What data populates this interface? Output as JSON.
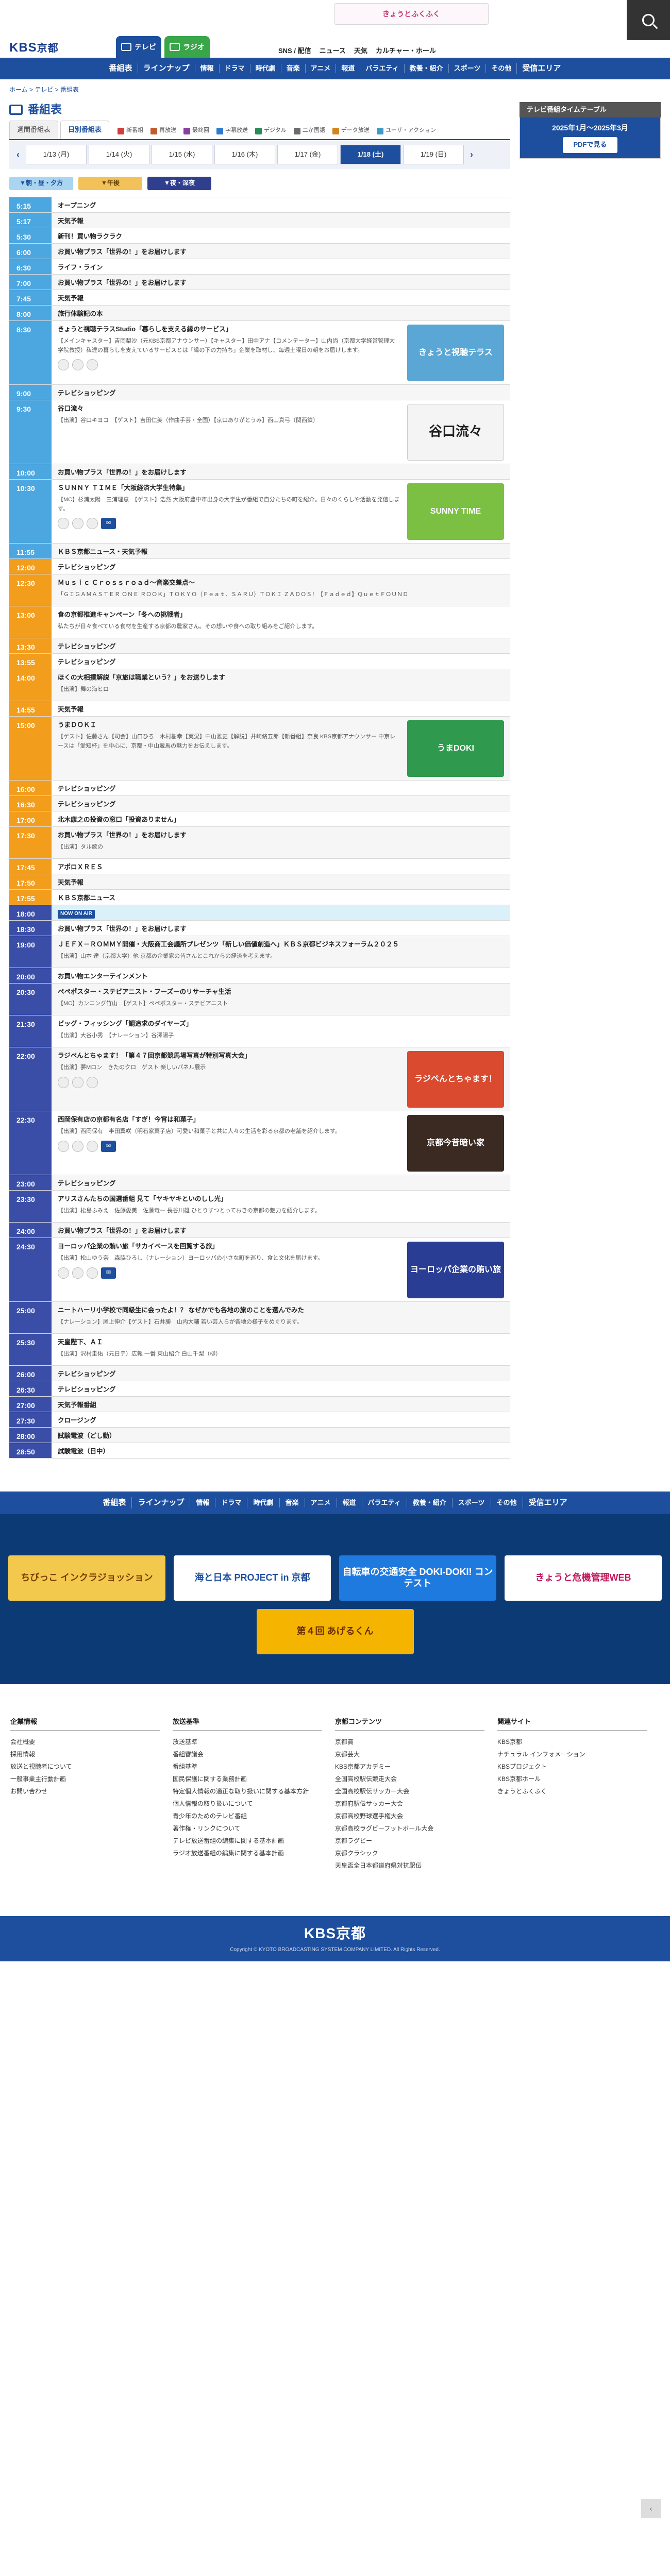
{
  "header": {
    "logo_ja": "KBS",
    "logo_kyoto": "京都",
    "top_banner": "きょうとふくふく",
    "tab_tv": "テレビ",
    "tab_radio": "ラジオ",
    "top_links": [
      "SNS / 配信",
      "ニュース",
      "天気",
      "カルチャー・ホール"
    ]
  },
  "gnav": {
    "main": "番組表",
    "items": [
      "ラインナップ",
      "情報",
      "ドラマ",
      "時代劇",
      "音楽",
      "アニメ",
      "報道",
      "バラエティ",
      "教養・紹介",
      "スポーツ",
      "その他",
      "受信エリア"
    ]
  },
  "breadcrumb": "ホーム > テレビ > 番組表",
  "page_title": "番組表",
  "mode_tabs": [
    "週間番組表",
    "日別番組表"
  ],
  "legend": [
    "新番組",
    "再放送",
    "最終回",
    "字幕放送",
    "デジタル",
    "二か国語",
    "データ放送",
    "ユーザ・アクション"
  ],
  "days": [
    "1/13 (月)",
    "1/14 (火)",
    "1/15 (水)",
    "1/16 (木)",
    "1/17 (金)",
    "1/18 (土)",
    "1/19 (日)"
  ],
  "selected_day": "1/18 (土)",
  "time_bands": [
    "朝・昼・夕方",
    "午後",
    "夜・深夜"
  ],
  "programs": [
    {
      "time": "5:15",
      "band": "m",
      "title": "オープニング"
    },
    {
      "time": "5:17",
      "band": "m",
      "title": "天気予報"
    },
    {
      "time": "5:30",
      "band": "m",
      "title": "新刊！買い物ラクラク"
    },
    {
      "time": "6:00",
      "band": "m",
      "title": "お買い物プラス「世界の！」をお届けします"
    },
    {
      "time": "6:30",
      "band": "m",
      "title": "ライフ・ライン"
    },
    {
      "time": "7:00",
      "band": "m",
      "title": "お買い物プラス「世界の！」をお届けします"
    },
    {
      "time": "7:45",
      "band": "m",
      "title": "天気予報"
    },
    {
      "time": "8:00",
      "band": "m",
      "title": "旅行体験記の本"
    },
    {
      "time": "8:30",
      "band": "m",
      "title": "きょうと視聴テラスStudio「暮らしを支える縁のサービス」",
      "desc": "【メインキャスター】吉岡梨沙（元KBS京都アナウンサー）【キャスター】田中アナ【コメンテーター】山内尚（京都大学経営管理大学院教授）私達の暮らしを支えているサービスとは「縁の下の力持ち」企業を取材し、毎週土曜日の朝をお届けします。",
      "thumb": "きょうと視聴テラス",
      "thumb_color": "#5aa7d6",
      "social": true
    },
    {
      "time": "9:00",
      "band": "m",
      "title": "テレビショッピング"
    },
    {
      "time": "9:30",
      "band": "m",
      "title": "谷口流々",
      "desc": "【出演】谷口キヨコ　【ゲスト】吉田仁美（作曲手芸・全国）【京口ありがとうみ】西山真弓（関西鉄）",
      "thumb": "谷口流々",
      "thumb_color": "#f4f4f4"
    },
    {
      "time": "10:00",
      "band": "m",
      "title": "お買い物プラス「世界の！」をお届けします"
    },
    {
      "time": "10:30",
      "band": "m",
      "title": "ＳＵＮＮＹ ＴＩＭＥ「大阪経済大学生特集」",
      "desc": "【MC】杉浦太陽　三浦理恵　【ゲスト】浩然 大阪府豊中市出身の大学生が番組で自分たちの町を紹介。日々のくらしや活動を発信します。",
      "thumb": "SUNNY TIME",
      "thumb_color": "#7bc043",
      "social": true,
      "message": true
    },
    {
      "time": "11:55",
      "band": "m",
      "title": "ＫＢＳ京都ニュース・天気予報"
    },
    {
      "time": "12:00",
      "band": "d",
      "title": "テレビショッピング"
    },
    {
      "time": "12:30",
      "band": "d",
      "title": "Ｍｕｓｉｃ Ｃｒｏｓｓｒｏａｄ～音楽交差点～",
      "desc": "「ＧＩＧＡＭＡＳＴＥＲ ＯＮＥ ＲＯＯＫ」ＴＯＫＹＯ（Ｆｅａｔ．ＳＡＲＵ）ＴＯＫＩ ＺＡＤＯＳ！【Ｆａｄｅｄ】ＱｕｅｔＦＯＵＮＤ"
    },
    {
      "time": "13:00",
      "band": "d",
      "title": "食の京都推進キャンペーン「冬への挑戦者」",
      "desc": "私たちが日々食べている食材を生産する京都の農家さん。その想いや食への取り組みをご紹介します。"
    },
    {
      "time": "13:30",
      "band": "d",
      "title": "テレビショッピング"
    },
    {
      "time": "13:55",
      "band": "d",
      "title": "テレビショッピング"
    },
    {
      "time": "14:00",
      "band": "d",
      "title": "ほくの大相撲解説「京旅は職業という？」をお送りします",
      "desc": "【出演】舞の海ヒロ"
    },
    {
      "time": "14:55",
      "band": "d",
      "title": "天気予報"
    },
    {
      "time": "15:00",
      "band": "d",
      "title": "うまＤＯＫＩ",
      "desc": "【ゲスト】佐藤さん【司会】山口ひろ　木村樹幸【実況】中山雅史【解説】井崎脩五郎【新番組】奈良 KBS京都アナウンサー 中京レースは「愛知杯」を中心に、京都・中山競馬の魅力をお伝えします。",
      "thumb": "うまDOKI",
      "thumb_color": "#2f9a4d"
    },
    {
      "time": "16:00",
      "band": "d",
      "title": "テレビショッピング"
    },
    {
      "time": "16:30",
      "band": "d",
      "title": "テレビショッピング"
    },
    {
      "time": "17:00",
      "band": "d",
      "title": "北木康之の投資の窓口「投資ありません」"
    },
    {
      "time": "17:30",
      "band": "d",
      "title": "お買い物プラス「世界の！」をお届けします",
      "desc": "【出演】タル歌の"
    },
    {
      "time": "17:45",
      "band": "d",
      "title": "アポロＸＲＥＳ"
    },
    {
      "time": "17:50",
      "band": "d",
      "title": "天気予報"
    },
    {
      "time": "17:55",
      "band": "d",
      "title": "ＫＢＳ京都ニュース"
    },
    {
      "time": "18:00",
      "band": "n",
      "title": "お買い物プラス「世界の！」をお届けします",
      "onair": "NOW ON AIR"
    },
    {
      "time": "18:30",
      "band": "n",
      "title": "お買い物プラス「世界の！」をお届けします"
    },
    {
      "time": "19:00",
      "band": "n",
      "title": "ＪＥＦＸ－ＲＯＭＭＹ開催・大阪商工会議所プレゼンツ「新しい価値創造へ」ＫＢＳ京都ビジネスフォーラム２０２５",
      "desc": "【出演】山本 達（京都大学）他 京都の企業家の皆さんとこれからの経済を考えます。"
    },
    {
      "time": "20:00",
      "band": "n",
      "title": "お買い物エンターテインメント"
    },
    {
      "time": "20:30",
      "band": "n",
      "title": "ペペポスター・ステビアニスト・フーズーのリサーチャ生活",
      "desc": "【MC】カンニング竹山　【ゲスト】ペペポスター・ステビアニスト"
    },
    {
      "time": "21:30",
      "band": "n",
      "title": "ビッグ・フィッシング「鯛追求のダイヤーズ」",
      "desc": "【出演】大谷小秀　【ナレーション】谷澤陽子"
    },
    {
      "time": "22:00",
      "band": "n",
      "title": "ラジペんとちゃます！「第４７回京都競馬場写真が特別写真大会」",
      "desc": "【出演】夢Mロン　きたのクロ　ゲスト 楽しいパネル展示",
      "thumb": "ラジペんとちゃます！",
      "thumb_color": "#d94a2e",
      "social": true
    },
    {
      "time": "22:30",
      "band": "n",
      "title": "西岡保有店の京都有名店「すぎ！今宵は和菓子」",
      "desc": "【出演】西岡保有　半田翼咲（明石家菓子店）可愛い和菓子と共に人々の生活を彩る京都の老舗を紹介します。",
      "thumb": "京都今昔暗い家",
      "thumb_color": "#3a2a22",
      "social": true,
      "message": true
    },
    {
      "time": "23:00",
      "band": "n",
      "title": "テレビショッピング"
    },
    {
      "time": "23:30",
      "band": "n",
      "title": "アリスさんたちの国選番組 見て「ヤキヤキといのしし光」",
      "desc": "【出演】松島ふみえ　佐藤愛美　佐藤竜一 長谷川雄 ひとりずつとっておきの京都の魅力を紹介します。"
    },
    {
      "time": "24:00",
      "band": "n",
      "title": "お買い物プラス「世界の！」をお届けします"
    },
    {
      "time": "24:30",
      "band": "n",
      "title": "ヨーロッパ企業の賄い旅「サカイベースを回覧する旅」",
      "desc": "【出演】松山ゆう奈　森脇ひろし（ナレーション）ヨーロッパの小さな町を巡り、食と文化を届けます。",
      "thumb": "ヨーロッパ企業の賄い旅",
      "thumb_color": "#2a3d94",
      "social": true,
      "message": true
    },
    {
      "time": "25:00",
      "band": "n",
      "title": "ニートハーリ小学校で同級生に会ったよ！？ なぜかでも各地の旅のことを選んでみた",
      "desc": "【ナレーション】尾上伸介【ゲスト】石井勝　山内大輔 若い芸人らが各地の様子をめぐります。"
    },
    {
      "time": "25:30",
      "band": "n",
      "title": "天皇陛下、ＡＩ",
      "desc": "【出演】沢村圭佑（元日テ）広報 一番 東山紹介 白山千梨（柳）"
    },
    {
      "time": "26:00",
      "band": "n",
      "title": "テレビショッピング"
    },
    {
      "time": "26:30",
      "band": "n",
      "title": "テレビショッピング"
    },
    {
      "time": "27:00",
      "band": "n",
      "title": "天気予報番組"
    },
    {
      "time": "27:30",
      "band": "n",
      "title": "クロージング"
    },
    {
      "time": "28:00",
      "band": "n",
      "title": "試験電波（どし動）"
    },
    {
      "time": "28:50",
      "band": "n",
      "title": "試験電波（日中）"
    }
  ],
  "sidebar": {
    "head": "テレビ番組タイムテーブル",
    "period": "2025年1月〜2025年3月",
    "pdf_button": "PDFで見る"
  },
  "footer_nav": {
    "main": "番組表",
    "items": [
      "ラインナップ",
      "情報",
      "ドラマ",
      "時代劇",
      "音楽",
      "アニメ",
      "報道",
      "バラエティ",
      "教養・紹介",
      "スポーツ",
      "その他",
      "受信エリア"
    ]
  },
  "banners": [
    {
      "text": "ちびっこ インクラジョッション",
      "color": "#f2c94c",
      "fg": "#7a3e00"
    },
    {
      "text": "海と日本 PROJECT in 京都",
      "color": "#ffffff",
      "fg": "#1d4f9e"
    },
    {
      "text": "自転車の交通安全 DOKI-DOKI! コンテスト",
      "color": "#1f7ae0",
      "fg": "#ffffff"
    },
    {
      "text": "きょうと危機管理WEB",
      "color": "#ffffff",
      "fg": "#c2185b"
    },
    {
      "text": "第４回 あげるくん",
      "color": "#f4b400",
      "fg": "#6a2e00"
    }
  ],
  "footer_cols": [
    {
      "head": "企業情報",
      "links": [
        "会社概要",
        "採用情報",
        "放送と視聴者について",
        "一般事業主行動計画",
        "お問い合わせ"
      ]
    },
    {
      "head": "放送基準",
      "links": [
        "放送基準",
        "番組審議会",
        "番組基準",
        "国民保護に関する業務計画",
        "特定個人情報の適正な取り扱いに関する基本方針",
        "個人情報の取り扱いについて",
        "青少年のためのテレビ番組",
        "著作権・リンクについて",
        "テレビ放送番組の編集に関する基本計画",
        "ラジオ放送番組の編集に関する基本計画"
      ]
    },
    {
      "head": "京都コンテンツ",
      "links": [
        "京都賞",
        "京都芸大",
        "KBS京都アカデミー",
        "全国高校駅伝競走大会",
        "全国高校駅伝サッカー大会",
        "京都府駅伝サッカー大会",
        "京都高校野球選手権大会",
        "京都高校ラグビーフットボール大会",
        "京都ラグビー",
        "京都クラシック",
        "天皇盃全日本都道府県対抗駅伝"
      ]
    },
    {
      "head": "関連サイト",
      "links": [
        "KBS京都",
        "ナチュラル インフォメーション",
        "KBSプロジェクト",
        "KBS京都ホール",
        "きょうとふくふく"
      ]
    }
  ],
  "copyright": "Copyright © KYOTO BROADCASTING SYSTEM COMPANY LIMITED. All Rights Reserved."
}
